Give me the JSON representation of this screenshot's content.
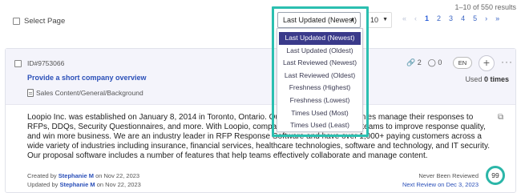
{
  "results_text": "1–10 of 550 results",
  "select_page_label": "Select Page",
  "sort": {
    "selected": "Last Updated (Newest)",
    "options": [
      "Last Updated (Newest)",
      "Last Updated (Oldest)",
      "Last Reviewed (Newest)",
      "Last Reviewed (Oldest)",
      "Freshness (Highest)",
      "Freshness (Lowest)",
      "Times Used (Most)",
      "Times Used (Least)"
    ]
  },
  "per_page": "10",
  "pagination": {
    "first": "«",
    "prev": "‹",
    "pages": [
      "1",
      "2",
      "3",
      "4",
      "5"
    ],
    "current": "1",
    "next": "›",
    "last": "»"
  },
  "card": {
    "id": "ID#9753066",
    "title": "Provide a short company overview",
    "path": "Sales Content/General/Background",
    "linked_count": "2",
    "comment_count": "0",
    "language": "EN",
    "used_prefix": "Used",
    "used_value": "0 times",
    "body": "Loopio Inc. was established on January 8, 2014 in Toronto, Ontario. Our platform helps companies manage their responses to RFPs, DDQs, Security Questionnaires, and more. With Loopio, companies can empower their teams to improve response quality, and win more business. We are an industry leader in RFP Response Software and have over 1,000+ paying customers across a wide variety of industries including insurance, financial services, healthcare technologies, software and technology, and IT security. Our proposal software includes a number of features that help teams effectively collaborate and manage content.",
    "created_prefix": "Created by",
    "created_by": "Stephanie M",
    "created_on": "on Nov 22, 2023",
    "updated_prefix": "Updated by",
    "updated_by": "Stephanie M",
    "updated_on": "on Nov 22, 2023",
    "review_status": "Never Been Reviewed",
    "next_review": "Next Review on Dec 3, 2023",
    "score": "99"
  },
  "colors": {
    "highlight": "#2bbfb0",
    "accent": "#2a4fb8",
    "menu_selected": "#3a3a8a"
  }
}
